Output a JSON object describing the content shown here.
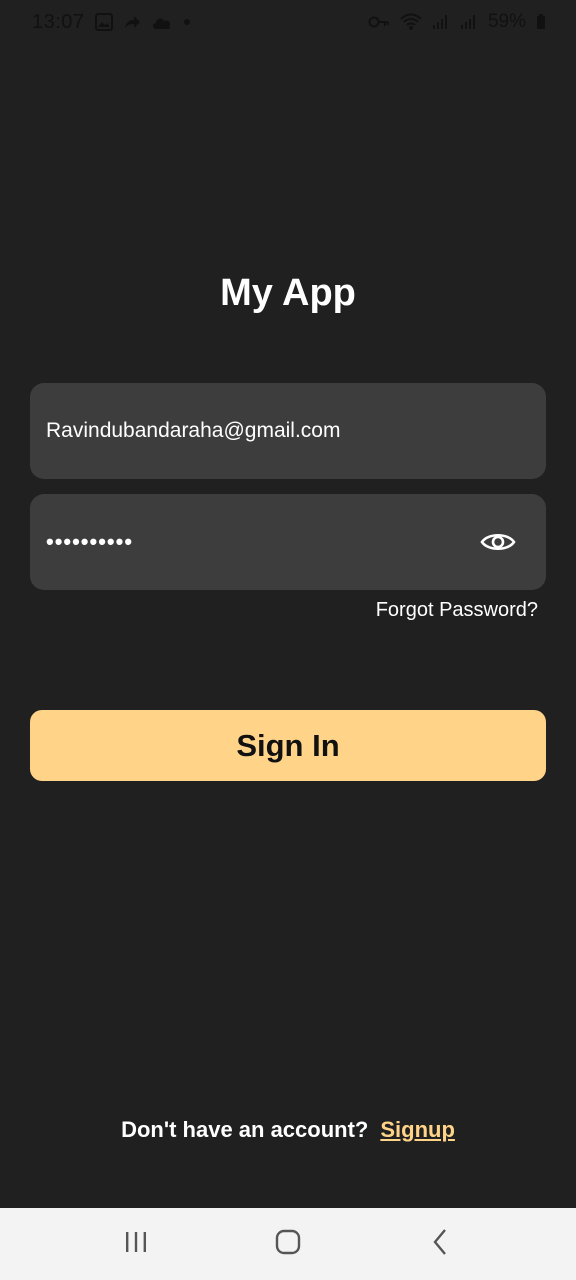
{
  "status_bar": {
    "time": "13:07",
    "battery": "59%",
    "icons": [
      "gallery-icon",
      "share-arrow-icon",
      "cloud-icon",
      "dot-icon",
      "key-icon",
      "wifi-icon",
      "signal-icon",
      "signal-icon",
      "battery-icon"
    ]
  },
  "app": {
    "title": "My App"
  },
  "login": {
    "email_value": "Ravindubandaraha@gmail.com",
    "password_masked": "••••••••••",
    "forgot_label": "Forgot Password?",
    "signin_label": "Sign In",
    "signup_prompt": "Don't have an account?",
    "signup_label": "Signup"
  },
  "colors": {
    "background": "#202020",
    "field": "#3d3d3d",
    "accent": "#ffd488",
    "nav_bar": "#f3f3f3"
  },
  "nav_bar": {
    "icons": [
      "recents-icon",
      "home-icon",
      "back-icon"
    ]
  }
}
